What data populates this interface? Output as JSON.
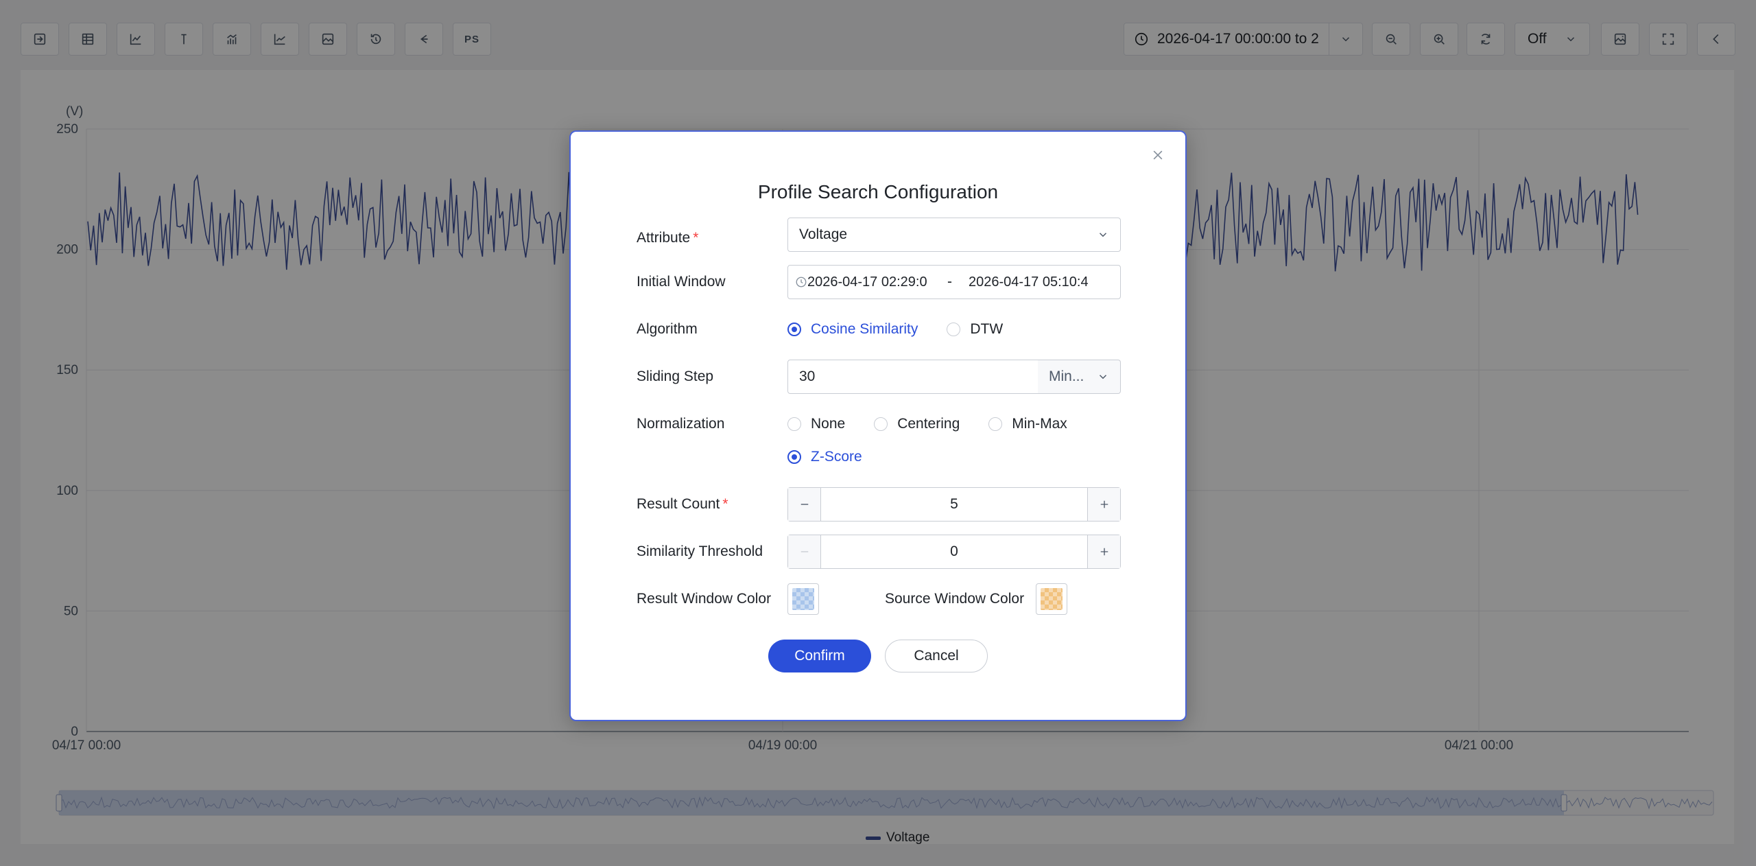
{
  "toolbar": {
    "icons": [
      "export-icon",
      "table-icon",
      "line-chart-icon",
      "marker-icon",
      "bar-line-icon",
      "area-chart-icon",
      "image-icon",
      "history-icon",
      "share-icon",
      "profile-search-icon"
    ],
    "ps_label": "PS",
    "time_range": "2026-04-17 00:00:00 to 2",
    "refresh": "Off"
  },
  "chart_data": {
    "type": "line",
    "ylabel": "(V)",
    "ylim": [
      0,
      250
    ],
    "yticks": [
      "250",
      "200",
      "150",
      "100",
      "50",
      "0"
    ],
    "xticks": [
      "04/17 00:00",
      "04/19 00:00",
      "04/21 00:00"
    ],
    "series": [
      {
        "name": "Voltage",
        "color": "#3d4f9a",
        "range": [
          190,
          236
        ],
        "mean": 212
      }
    ],
    "legend": "bottom-center"
  },
  "modal": {
    "title": "Profile Search Configuration",
    "attribute": {
      "label": "Attribute",
      "value": "Voltage"
    },
    "initial_window": {
      "label": "Initial Window",
      "start": "2026-04-17 02:29:0",
      "separator": "-",
      "end": "2026-04-17 05:10:4"
    },
    "algorithm": {
      "label": "Algorithm",
      "options": [
        "Cosine Similarity",
        "DTW"
      ],
      "selected": "Cosine Similarity"
    },
    "sliding_step": {
      "label": "Sliding Step",
      "value": "30",
      "unit": "Min..."
    },
    "normalization": {
      "label": "Normalization",
      "options": [
        "None",
        "Centering",
        "Min-Max",
        "Z-Score"
      ],
      "selected": "Z-Score"
    },
    "result_count": {
      "label": "Result Count",
      "value": "5"
    },
    "similarity_threshold": {
      "label": "Similarity Threshold",
      "value": "0"
    },
    "result_color": {
      "label": "Result Window Color",
      "color": "#a9c4ea"
    },
    "source_color": {
      "label": "Source Window Color",
      "color": "#f1c27e"
    },
    "confirm": "Confirm",
    "cancel": "Cancel",
    "required_mark": "*"
  }
}
